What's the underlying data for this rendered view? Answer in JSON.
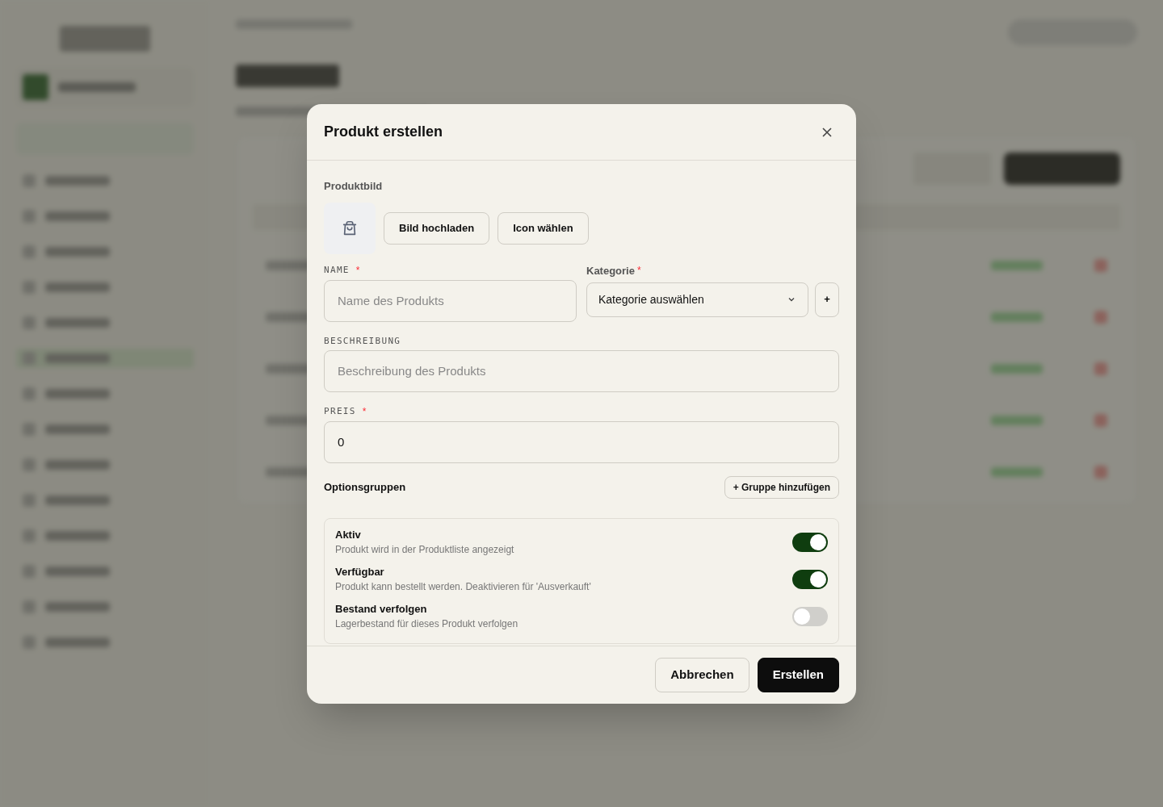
{
  "dialog": {
    "title": "Produkt erstellen",
    "image_section": {
      "label": "Produktbild",
      "buttons": [
        "Bild hochladen",
        "Icon wählen"
      ]
    },
    "name_field": {
      "label": "NAME",
      "required_mark": "*",
      "placeholder": "Name des Produkts"
    },
    "category_field": {
      "label": "Kategorie",
      "required_mark": "*",
      "value": "Kategorie auswählen",
      "add_button": "+"
    },
    "description_field": {
      "label": "BESCHREIBUNG",
      "placeholder": "Beschreibung des Produkts"
    },
    "price_field": {
      "label": "PREIS",
      "required_mark": "*",
      "value": "0"
    },
    "option_groups": {
      "label": "Optionsgruppen",
      "add_button": "+ Gruppe hinzufügen"
    },
    "toggles": [
      {
        "title": "Aktiv",
        "description": "Produkt wird in der Produktliste angezeigt",
        "on": true
      },
      {
        "title": "Verfügbar",
        "description": "Produkt kann bestellt werden. Deaktivieren für 'Ausverkauft'",
        "on": true
      },
      {
        "title": "Bestand verfolgen",
        "description": "Lagerbestand für dieses Produkt verfolgen",
        "on": false
      }
    ],
    "footer_buttons": [
      {
        "label": "Abbrechen",
        "kind": "secondary"
      },
      {
        "label": "Erstellen",
        "kind": "primary"
      }
    ]
  }
}
